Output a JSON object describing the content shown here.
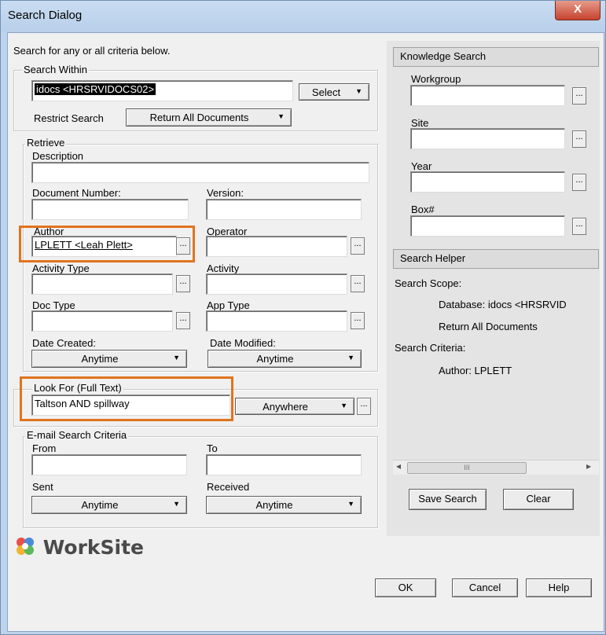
{
  "window": {
    "title": "Search Dialog",
    "close_glyph": "X"
  },
  "intro": "Search for any or all  criteria below.",
  "search_within": {
    "legend": "Search Within",
    "library_value": "idocs <HRSRVIDOCS02>",
    "select_label": "Select",
    "restrict_label": "Restrict Search",
    "restrict_value": "Return All Documents"
  },
  "retrieve": {
    "legend": "Retrieve",
    "description_label": "Description",
    "document_number_label": "Document Number:",
    "version_label": "Version:",
    "author_label": "Author",
    "author_value": "LPLETT <Leah Plett>",
    "operator_label": "Operator",
    "activity_type_label": "Activity Type",
    "activity_label": "Activity",
    "doc_type_label": "Doc Type",
    "app_type_label": "App Type",
    "date_created_label": "Date Created:",
    "date_created_value": "Anytime",
    "date_modified_label": "Date Modified:",
    "date_modified_value": "Anytime",
    "browse_glyph": "..."
  },
  "look_for": {
    "legend": "Look For (Full Text)",
    "value": "Taltson AND spillway",
    "where_value": "Anywhere"
  },
  "email": {
    "legend": "E-mail Search Criteria",
    "from_label": "From",
    "to_label": "To",
    "sent_label": "Sent",
    "sent_value": "Anytime",
    "received_label": "Received",
    "received_value": "Anytime"
  },
  "knowledge": {
    "header": "Knowledge Search",
    "workgroup_label": "Workgroup",
    "site_label": "Site",
    "year_label": "Year",
    "box_label": "Box#"
  },
  "helper": {
    "header": "Search Helper",
    "scope_label": "Search Scope:",
    "scope_database": "Database: idocs <HRSRVID",
    "scope_return": "Return All Documents",
    "criteria_label": "Search Criteria:",
    "criteria_author": "Author: LPLETT",
    "scroll_left": "◂",
    "scroll_thumb": "III",
    "scroll_right": "▸"
  },
  "actions": {
    "save_search": "Save Search",
    "clear": "Clear",
    "ok": "OK",
    "cancel": "Cancel",
    "help": "Help"
  },
  "brand": {
    "name": "WorkSite"
  },
  "colors": {
    "highlight": "#e0741d",
    "title_bg": "#c9dcf1",
    "close_red": "#c5432f"
  },
  "icons": {
    "dropdown": "chevron-down-icon",
    "close": "close-icon",
    "logo": "worksite-logo-icon"
  }
}
